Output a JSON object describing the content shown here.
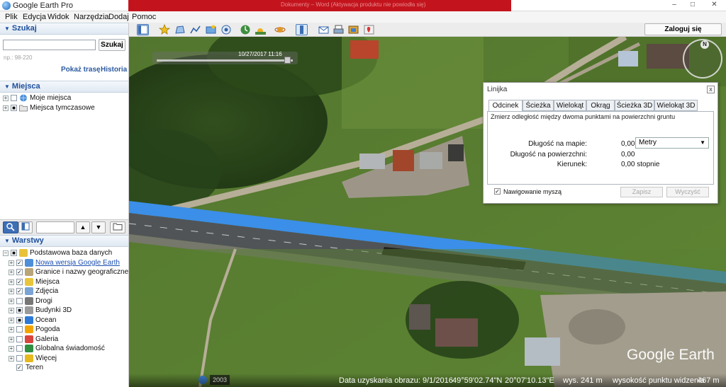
{
  "window": {
    "title": "Google Earth Pro",
    "blurred_text": "Dokumenty – Word (Aktywacja produktu nie powiodła się)",
    "minimize": "–",
    "maximize": "□",
    "close": "✕"
  },
  "menu": [
    "Plik",
    "Edycja",
    "Widok",
    "Narzędzia",
    "Dodaj",
    "Pomoc"
  ],
  "toolbar": {
    "login_label": "Zaloguj się"
  },
  "search": {
    "header": "Szukaj",
    "button_label": "Szukaj",
    "placeholder": "",
    "hint": "np.: 98-220",
    "route_link": "Pokaż trasę",
    "history_link": "Historia"
  },
  "places": {
    "header": "Miejsca",
    "items": [
      {
        "label": "Moje miejsca"
      },
      {
        "label": "Miejsca tymczasowe"
      }
    ]
  },
  "layers": {
    "header": "Warstwy",
    "items": [
      {
        "label": "Podstawowa baza danych",
        "checked": "■"
      },
      {
        "label": "Nowa wersja Google Earth",
        "checked": "✓"
      },
      {
        "label": "Granice i nazwy geograficzne",
        "checked": "✓"
      },
      {
        "label": "Miejsca",
        "checked": "✓"
      },
      {
        "label": "Zdjęcia",
        "checked": "✓"
      },
      {
        "label": "Drogi",
        "checked": ""
      },
      {
        "label": "Budynki 3D",
        "checked": "■"
      },
      {
        "label": "Ocean",
        "checked": "■"
      },
      {
        "label": "Pogoda",
        "checked": ""
      },
      {
        "label": "Galeria",
        "checked": ""
      },
      {
        "label": "Globalna świadomość",
        "checked": ""
      },
      {
        "label": "Więcej",
        "checked": ""
      },
      {
        "label": "Teren",
        "checked": "✓"
      }
    ]
  },
  "ruler": {
    "title": "Linijka",
    "close": "x",
    "tabs": [
      "Odcinek",
      "Ścieżka",
      "Wielokąt",
      "Okrąg",
      "Ścieżka 3D",
      "Wielokąt 3D"
    ],
    "active_tab": "Odcinek",
    "description": "Zmierz odległość między dwoma punktami na powierzchni gruntu",
    "rows": [
      {
        "label": "Długość na mapie:",
        "value": "0,00"
      },
      {
        "label": "Długość na powierzchni:",
        "value": "0,00"
      },
      {
        "label": "Kierunek:",
        "value": "0,00 stopnie"
      }
    ],
    "unit": "Metry",
    "mouse_nav_label": "Nawigowanie myszą",
    "mouse_nav_checked": "✓",
    "save_label": "Zapisz",
    "clear_label": "Wyczyść"
  },
  "map": {
    "timestamp": "10/27/2017  11:16",
    "year_badge": "2003",
    "logo": "Google Earth",
    "compass_n": "N"
  },
  "status": {
    "imagery_date": "Data uzyskania obrazu: 9/1/2016",
    "lat": "49°59'02.74\"N",
    "lon": "20°07'10.13\"E",
    "elevation": "wys.  241 m",
    "eye_alt": "wysokość punktu widzenia",
    "eye_alt_value": "467 m"
  },
  "colors": {
    "accent": "#1e4f9c",
    "link": "#2c5aa0",
    "route": "#3b8fe8",
    "title_strip": "#c3141d"
  }
}
